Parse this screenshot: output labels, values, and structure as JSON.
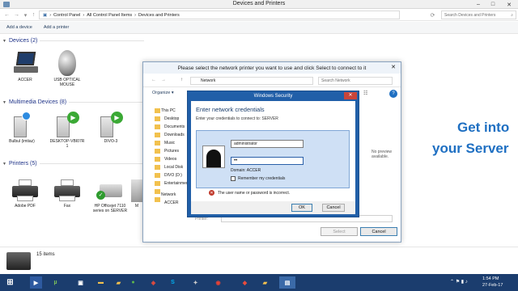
{
  "window": {
    "title": "Devices and Printers"
  },
  "address": {
    "path": [
      "Control Panel",
      "All Control Panel Items",
      "Devices and Printers"
    ],
    "search_placeholder": "Search Devices and Printers"
  },
  "commands": {
    "add_device": "Add a device",
    "add_printer": "Add a printer"
  },
  "sections": {
    "devices": {
      "label": "Devices (2)",
      "items": [
        "ACCER",
        "USB OPTICAL MOUSE"
      ]
    },
    "multimedia": {
      "label": "Multimedia Devices (8)",
      "items": [
        "Bulbul (imtiaz)",
        "DESKTOP-VBI07R 1",
        "DIVO-3"
      ]
    },
    "printers": {
      "label": "Printers (5)",
      "items": [
        "Adobe PDF",
        "Fax",
        "HP Officejet 7110 series on SERVER",
        "M"
      ]
    }
  },
  "status": {
    "count": "15 items"
  },
  "network_dialog": {
    "title": "Please select the network printer you want to use and click Select to connect to it",
    "address": "Network",
    "search_placeholder": "Search Network",
    "organize": "Organize",
    "tree": [
      "This PC",
      "Desktop",
      "Documents",
      "Downloads",
      "Music",
      "Pictures",
      "Videos",
      "Local Disk",
      "DIVO (D:)",
      "Entertainment",
      "Network",
      "ACCER"
    ],
    "no_preview": "No preview available.",
    "printer_label": "Printer:",
    "select_button": "Select",
    "cancel_button": "Cancel"
  },
  "security_dialog": {
    "title": "Windows Security",
    "heading": "Enter network credentials",
    "subheading": "Enter your credentials to connect to: SERVER",
    "username": "administrator",
    "password_mask": "••",
    "domain": "Domain: ACCER",
    "remember": "Remember my credentials",
    "error": "The user name or password is incorrect.",
    "ok": "OK",
    "cancel": "Cancel"
  },
  "ad": {
    "line1": "Get into",
    "line2": "your Server"
  },
  "clock": {
    "time": "1:54 PM",
    "date": "27-Feb-17"
  },
  "colors": {
    "accent": "#1e6fc2",
    "taskbar": "#1b3d6e",
    "dialog_frame": "#215fa8",
    "error": "#c0392b"
  }
}
